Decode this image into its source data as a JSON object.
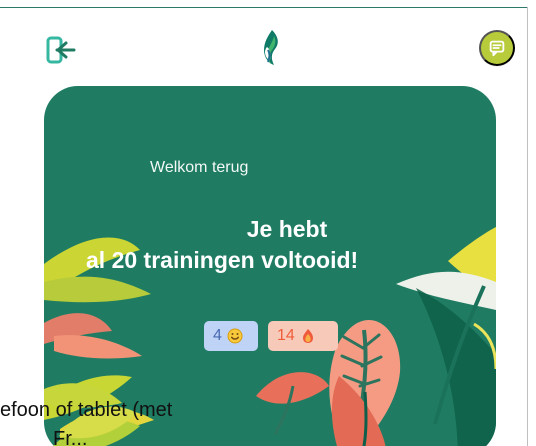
{
  "header": {
    "logout_icon": "logout-icon",
    "logo_icon": "brand-logo-icon",
    "chat_icon": "chat-icon",
    "colors": {
      "primary": "#1f7c62",
      "chat_button": "#b8cb3a"
    }
  },
  "hero": {
    "greeting": "Welkom terug",
    "headline_line_1": "Je hebt",
    "headline_line_2": "al 20 trainingen voltooid!",
    "badges": [
      {
        "value": "4",
        "icon": "smiley-icon"
      },
      {
        "value": "14",
        "icon": "fire-icon"
      }
    ]
  },
  "overlay_text": {
    "line_1": "efoon of tablet (met",
    "line_2": "Fr... "
  }
}
